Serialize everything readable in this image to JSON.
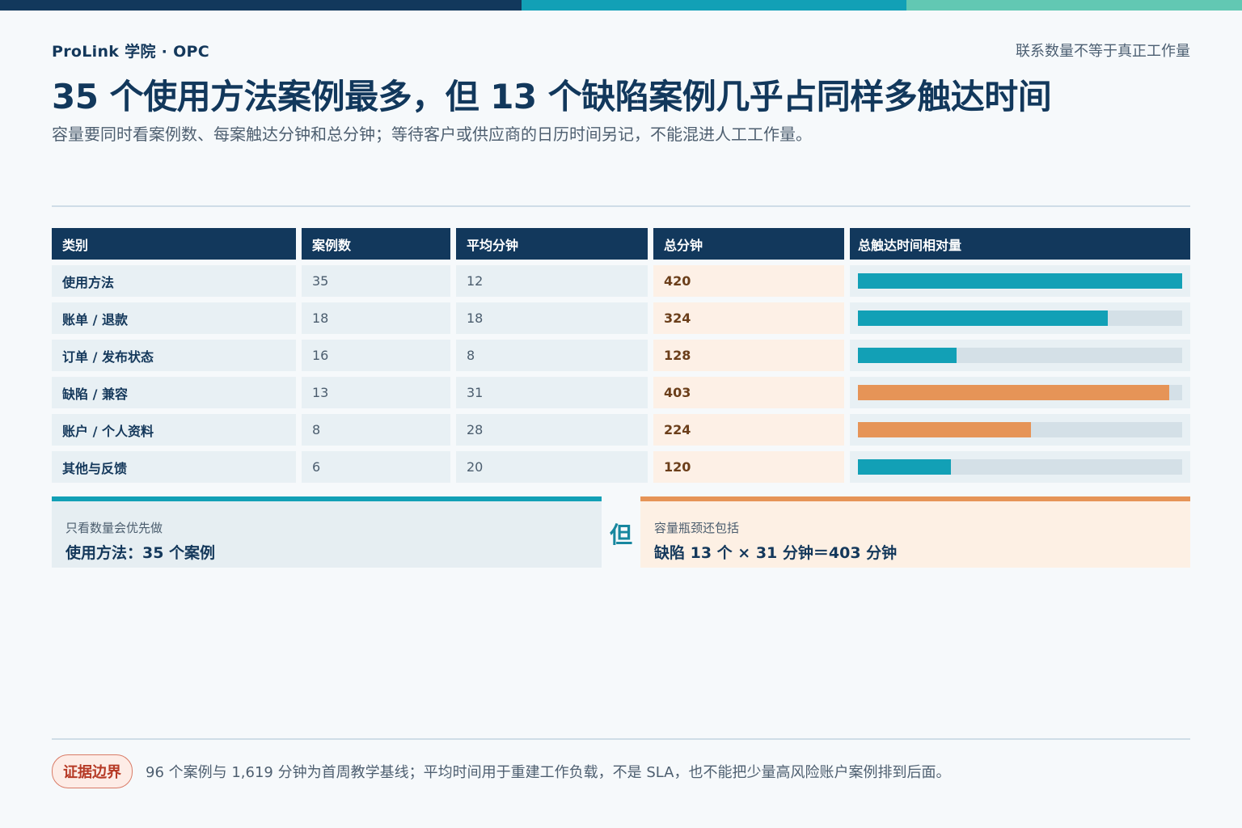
{
  "brand": "ProLink 学院 · OPC",
  "note_right": "联系数量不等于真正工作量",
  "title": "35 个使用方法案例最多，但 13 个缺陷案例几乎占同样多触达时间",
  "subtitle": "容量要同时看案例数、每案触达分钟和总分钟；等待客户或供应商的日历时间另记，不能混进人工工作量。",
  "colors": {
    "navy": "#12385c",
    "teal": "#12a0b6",
    "mint": "#62c8b3",
    "orange": "#e69457"
  },
  "table": {
    "headers": [
      "类别",
      "案例数",
      "平均分钟",
      "总分钟",
      "总触达时间相对量"
    ],
    "max_total": 420,
    "rows": [
      {
        "category": "使用方法",
        "cases": "35",
        "avg": "12",
        "total": "420",
        "total_value": 420,
        "bar_color": "#12a0b6"
      },
      {
        "category": "账单 / 退款",
        "cases": "18",
        "avg": "18",
        "total": "324",
        "total_value": 324,
        "bar_color": "#12a0b6"
      },
      {
        "category": "订单 / 发布状态",
        "cases": "16",
        "avg": "8",
        "total": "128",
        "total_value": 128,
        "bar_color": "#12a0b6"
      },
      {
        "category": "缺陷 / 兼容",
        "cases": "13",
        "avg": "31",
        "total": "403",
        "total_value": 403,
        "bar_color": "#e69457"
      },
      {
        "category": "账户 / 个人资料",
        "cases": "8",
        "avg": "28",
        "total": "224",
        "total_value": 224,
        "bar_color": "#e69457"
      },
      {
        "category": "其他与反馈",
        "cases": "6",
        "avg": "20",
        "total": "120",
        "total_value": 120,
        "bar_color": "#12a0b6"
      }
    ]
  },
  "callouts": {
    "left_small": "只看数量会优先做",
    "left_big": "使用方法：35 个案例",
    "but": "但",
    "right_small": "容量瓶颈还包括",
    "right_big": "缺陷 13 个 × 31 分钟＝403 分钟"
  },
  "footer": {
    "tag": "证据边界",
    "text": "96 个案例与 1,619 分钟为首周教学基线；平均时间用于重建工作负载，不是 SLA，也不能把少量高风险账户案例排到后面。"
  }
}
